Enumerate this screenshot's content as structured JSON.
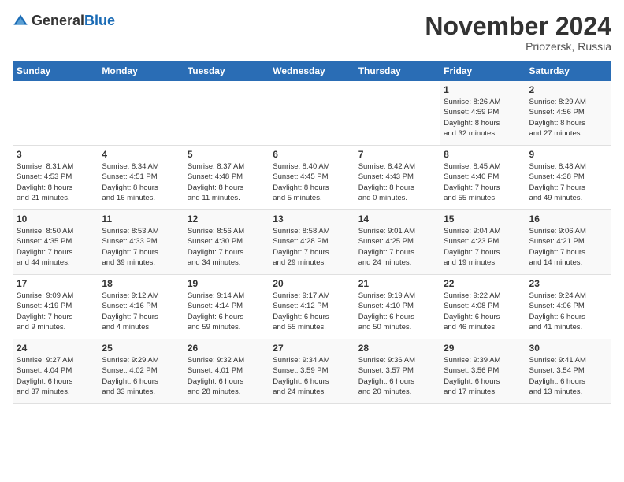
{
  "logo": {
    "general": "General",
    "blue": "Blue"
  },
  "title": "November 2024",
  "subtitle": "Priozersk, Russia",
  "header_days": [
    "Sunday",
    "Monday",
    "Tuesday",
    "Wednesday",
    "Thursday",
    "Friday",
    "Saturday"
  ],
  "weeks": [
    [
      {
        "day": "",
        "info": ""
      },
      {
        "day": "",
        "info": ""
      },
      {
        "day": "",
        "info": ""
      },
      {
        "day": "",
        "info": ""
      },
      {
        "day": "",
        "info": ""
      },
      {
        "day": "1",
        "info": "Sunrise: 8:26 AM\nSunset: 4:59 PM\nDaylight: 8 hours\nand 32 minutes."
      },
      {
        "day": "2",
        "info": "Sunrise: 8:29 AM\nSunset: 4:56 PM\nDaylight: 8 hours\nand 27 minutes."
      }
    ],
    [
      {
        "day": "3",
        "info": "Sunrise: 8:31 AM\nSunset: 4:53 PM\nDaylight: 8 hours\nand 21 minutes."
      },
      {
        "day": "4",
        "info": "Sunrise: 8:34 AM\nSunset: 4:51 PM\nDaylight: 8 hours\nand 16 minutes."
      },
      {
        "day": "5",
        "info": "Sunrise: 8:37 AM\nSunset: 4:48 PM\nDaylight: 8 hours\nand 11 minutes."
      },
      {
        "day": "6",
        "info": "Sunrise: 8:40 AM\nSunset: 4:45 PM\nDaylight: 8 hours\nand 5 minutes."
      },
      {
        "day": "7",
        "info": "Sunrise: 8:42 AM\nSunset: 4:43 PM\nDaylight: 8 hours\nand 0 minutes."
      },
      {
        "day": "8",
        "info": "Sunrise: 8:45 AM\nSunset: 4:40 PM\nDaylight: 7 hours\nand 55 minutes."
      },
      {
        "day": "9",
        "info": "Sunrise: 8:48 AM\nSunset: 4:38 PM\nDaylight: 7 hours\nand 49 minutes."
      }
    ],
    [
      {
        "day": "10",
        "info": "Sunrise: 8:50 AM\nSunset: 4:35 PM\nDaylight: 7 hours\nand 44 minutes."
      },
      {
        "day": "11",
        "info": "Sunrise: 8:53 AM\nSunset: 4:33 PM\nDaylight: 7 hours\nand 39 minutes."
      },
      {
        "day": "12",
        "info": "Sunrise: 8:56 AM\nSunset: 4:30 PM\nDaylight: 7 hours\nand 34 minutes."
      },
      {
        "day": "13",
        "info": "Sunrise: 8:58 AM\nSunset: 4:28 PM\nDaylight: 7 hours\nand 29 minutes."
      },
      {
        "day": "14",
        "info": "Sunrise: 9:01 AM\nSunset: 4:25 PM\nDaylight: 7 hours\nand 24 minutes."
      },
      {
        "day": "15",
        "info": "Sunrise: 9:04 AM\nSunset: 4:23 PM\nDaylight: 7 hours\nand 19 minutes."
      },
      {
        "day": "16",
        "info": "Sunrise: 9:06 AM\nSunset: 4:21 PM\nDaylight: 7 hours\nand 14 minutes."
      }
    ],
    [
      {
        "day": "17",
        "info": "Sunrise: 9:09 AM\nSunset: 4:19 PM\nDaylight: 7 hours\nand 9 minutes."
      },
      {
        "day": "18",
        "info": "Sunrise: 9:12 AM\nSunset: 4:16 PM\nDaylight: 7 hours\nand 4 minutes."
      },
      {
        "day": "19",
        "info": "Sunrise: 9:14 AM\nSunset: 4:14 PM\nDaylight: 6 hours\nand 59 minutes."
      },
      {
        "day": "20",
        "info": "Sunrise: 9:17 AM\nSunset: 4:12 PM\nDaylight: 6 hours\nand 55 minutes."
      },
      {
        "day": "21",
        "info": "Sunrise: 9:19 AM\nSunset: 4:10 PM\nDaylight: 6 hours\nand 50 minutes."
      },
      {
        "day": "22",
        "info": "Sunrise: 9:22 AM\nSunset: 4:08 PM\nDaylight: 6 hours\nand 46 minutes."
      },
      {
        "day": "23",
        "info": "Sunrise: 9:24 AM\nSunset: 4:06 PM\nDaylight: 6 hours\nand 41 minutes."
      }
    ],
    [
      {
        "day": "24",
        "info": "Sunrise: 9:27 AM\nSunset: 4:04 PM\nDaylight: 6 hours\nand 37 minutes."
      },
      {
        "day": "25",
        "info": "Sunrise: 9:29 AM\nSunset: 4:02 PM\nDaylight: 6 hours\nand 33 minutes."
      },
      {
        "day": "26",
        "info": "Sunrise: 9:32 AM\nSunset: 4:01 PM\nDaylight: 6 hours\nand 28 minutes."
      },
      {
        "day": "27",
        "info": "Sunrise: 9:34 AM\nSunset: 3:59 PM\nDaylight: 6 hours\nand 24 minutes."
      },
      {
        "day": "28",
        "info": "Sunrise: 9:36 AM\nSunset: 3:57 PM\nDaylight: 6 hours\nand 20 minutes."
      },
      {
        "day": "29",
        "info": "Sunrise: 9:39 AM\nSunset: 3:56 PM\nDaylight: 6 hours\nand 17 minutes."
      },
      {
        "day": "30",
        "info": "Sunrise: 9:41 AM\nSunset: 3:54 PM\nDaylight: 6 hours\nand 13 minutes."
      }
    ]
  ]
}
